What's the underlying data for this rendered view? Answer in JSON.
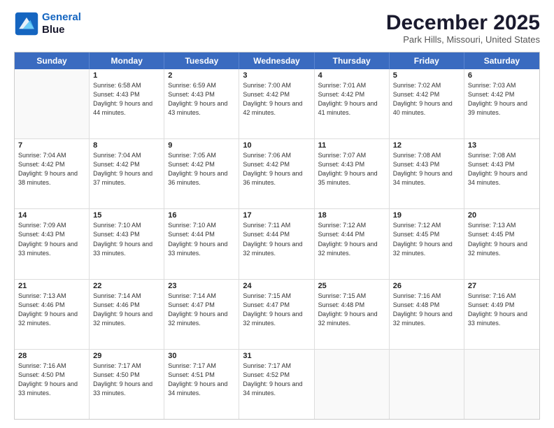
{
  "header": {
    "logo_line1": "General",
    "logo_line2": "Blue",
    "month_title": "December 2025",
    "location": "Park Hills, Missouri, United States"
  },
  "days_of_week": [
    "Sunday",
    "Monday",
    "Tuesday",
    "Wednesday",
    "Thursday",
    "Friday",
    "Saturday"
  ],
  "weeks": [
    [
      {
        "day": "",
        "sunrise": "",
        "sunset": "",
        "daylight": ""
      },
      {
        "day": "1",
        "sunrise": "Sunrise: 6:58 AM",
        "sunset": "Sunset: 4:43 PM",
        "daylight": "Daylight: 9 hours and 44 minutes."
      },
      {
        "day": "2",
        "sunrise": "Sunrise: 6:59 AM",
        "sunset": "Sunset: 4:43 PM",
        "daylight": "Daylight: 9 hours and 43 minutes."
      },
      {
        "day": "3",
        "sunrise": "Sunrise: 7:00 AM",
        "sunset": "Sunset: 4:42 PM",
        "daylight": "Daylight: 9 hours and 42 minutes."
      },
      {
        "day": "4",
        "sunrise": "Sunrise: 7:01 AM",
        "sunset": "Sunset: 4:42 PM",
        "daylight": "Daylight: 9 hours and 41 minutes."
      },
      {
        "day": "5",
        "sunrise": "Sunrise: 7:02 AM",
        "sunset": "Sunset: 4:42 PM",
        "daylight": "Daylight: 9 hours and 40 minutes."
      },
      {
        "day": "6",
        "sunrise": "Sunrise: 7:03 AM",
        "sunset": "Sunset: 4:42 PM",
        "daylight": "Daylight: 9 hours and 39 minutes."
      }
    ],
    [
      {
        "day": "7",
        "sunrise": "Sunrise: 7:04 AM",
        "sunset": "Sunset: 4:42 PM",
        "daylight": "Daylight: 9 hours and 38 minutes."
      },
      {
        "day": "8",
        "sunrise": "Sunrise: 7:04 AM",
        "sunset": "Sunset: 4:42 PM",
        "daylight": "Daylight: 9 hours and 37 minutes."
      },
      {
        "day": "9",
        "sunrise": "Sunrise: 7:05 AM",
        "sunset": "Sunset: 4:42 PM",
        "daylight": "Daylight: 9 hours and 36 minutes."
      },
      {
        "day": "10",
        "sunrise": "Sunrise: 7:06 AM",
        "sunset": "Sunset: 4:42 PM",
        "daylight": "Daylight: 9 hours and 36 minutes."
      },
      {
        "day": "11",
        "sunrise": "Sunrise: 7:07 AM",
        "sunset": "Sunset: 4:43 PM",
        "daylight": "Daylight: 9 hours and 35 minutes."
      },
      {
        "day": "12",
        "sunrise": "Sunrise: 7:08 AM",
        "sunset": "Sunset: 4:43 PM",
        "daylight": "Daylight: 9 hours and 34 minutes."
      },
      {
        "day": "13",
        "sunrise": "Sunrise: 7:08 AM",
        "sunset": "Sunset: 4:43 PM",
        "daylight": "Daylight: 9 hours and 34 minutes."
      }
    ],
    [
      {
        "day": "14",
        "sunrise": "Sunrise: 7:09 AM",
        "sunset": "Sunset: 4:43 PM",
        "daylight": "Daylight: 9 hours and 33 minutes."
      },
      {
        "day": "15",
        "sunrise": "Sunrise: 7:10 AM",
        "sunset": "Sunset: 4:43 PM",
        "daylight": "Daylight: 9 hours and 33 minutes."
      },
      {
        "day": "16",
        "sunrise": "Sunrise: 7:10 AM",
        "sunset": "Sunset: 4:44 PM",
        "daylight": "Daylight: 9 hours and 33 minutes."
      },
      {
        "day": "17",
        "sunrise": "Sunrise: 7:11 AM",
        "sunset": "Sunset: 4:44 PM",
        "daylight": "Daylight: 9 hours and 32 minutes."
      },
      {
        "day": "18",
        "sunrise": "Sunrise: 7:12 AM",
        "sunset": "Sunset: 4:44 PM",
        "daylight": "Daylight: 9 hours and 32 minutes."
      },
      {
        "day": "19",
        "sunrise": "Sunrise: 7:12 AM",
        "sunset": "Sunset: 4:45 PM",
        "daylight": "Daylight: 9 hours and 32 minutes."
      },
      {
        "day": "20",
        "sunrise": "Sunrise: 7:13 AM",
        "sunset": "Sunset: 4:45 PM",
        "daylight": "Daylight: 9 hours and 32 minutes."
      }
    ],
    [
      {
        "day": "21",
        "sunrise": "Sunrise: 7:13 AM",
        "sunset": "Sunset: 4:46 PM",
        "daylight": "Daylight: 9 hours and 32 minutes."
      },
      {
        "day": "22",
        "sunrise": "Sunrise: 7:14 AM",
        "sunset": "Sunset: 4:46 PM",
        "daylight": "Daylight: 9 hours and 32 minutes."
      },
      {
        "day": "23",
        "sunrise": "Sunrise: 7:14 AM",
        "sunset": "Sunset: 4:47 PM",
        "daylight": "Daylight: 9 hours and 32 minutes."
      },
      {
        "day": "24",
        "sunrise": "Sunrise: 7:15 AM",
        "sunset": "Sunset: 4:47 PM",
        "daylight": "Daylight: 9 hours and 32 minutes."
      },
      {
        "day": "25",
        "sunrise": "Sunrise: 7:15 AM",
        "sunset": "Sunset: 4:48 PM",
        "daylight": "Daylight: 9 hours and 32 minutes."
      },
      {
        "day": "26",
        "sunrise": "Sunrise: 7:16 AM",
        "sunset": "Sunset: 4:48 PM",
        "daylight": "Daylight: 9 hours and 32 minutes."
      },
      {
        "day": "27",
        "sunrise": "Sunrise: 7:16 AM",
        "sunset": "Sunset: 4:49 PM",
        "daylight": "Daylight: 9 hours and 33 minutes."
      }
    ],
    [
      {
        "day": "28",
        "sunrise": "Sunrise: 7:16 AM",
        "sunset": "Sunset: 4:50 PM",
        "daylight": "Daylight: 9 hours and 33 minutes."
      },
      {
        "day": "29",
        "sunrise": "Sunrise: 7:17 AM",
        "sunset": "Sunset: 4:50 PM",
        "daylight": "Daylight: 9 hours and 33 minutes."
      },
      {
        "day": "30",
        "sunrise": "Sunrise: 7:17 AM",
        "sunset": "Sunset: 4:51 PM",
        "daylight": "Daylight: 9 hours and 34 minutes."
      },
      {
        "day": "31",
        "sunrise": "Sunrise: 7:17 AM",
        "sunset": "Sunset: 4:52 PM",
        "daylight": "Daylight: 9 hours and 34 minutes."
      },
      {
        "day": "",
        "sunrise": "",
        "sunset": "",
        "daylight": ""
      },
      {
        "day": "",
        "sunrise": "",
        "sunset": "",
        "daylight": ""
      },
      {
        "day": "",
        "sunrise": "",
        "sunset": "",
        "daylight": ""
      }
    ]
  ]
}
